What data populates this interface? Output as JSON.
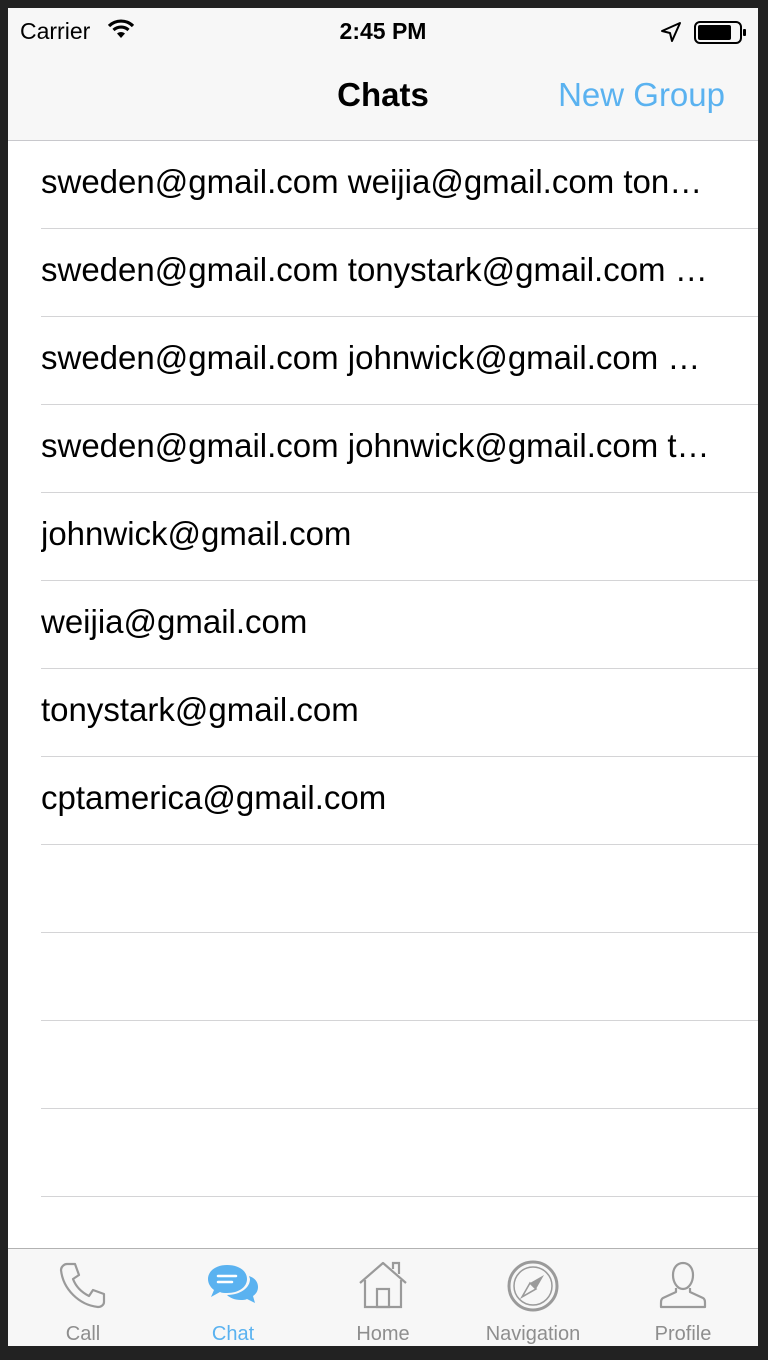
{
  "status_bar": {
    "carrier": "Carrier",
    "time": "2:45 PM"
  },
  "nav": {
    "title": "Chats",
    "action": "New Group"
  },
  "chats": [
    {
      "label": "sweden@gmail.com weijia@gmail.com tonystark@gmail.com"
    },
    {
      "label": "sweden@gmail.com tonystark@gmail.com cptamerica@gmail.com"
    },
    {
      "label": "sweden@gmail.com johnwick@gmail.com weijia@gmail.com"
    },
    {
      "label": "sweden@gmail.com johnwick@gmail.com tonystark@gmail.com"
    },
    {
      "label": "johnwick@gmail.com"
    },
    {
      "label": "weijia@gmail.com"
    },
    {
      "label": "tonystark@gmail.com"
    },
    {
      "label": "cptamerica@gmail.com"
    },
    {
      "label": ""
    },
    {
      "label": ""
    },
    {
      "label": ""
    },
    {
      "label": ""
    },
    {
      "label": ""
    }
  ],
  "tabs": [
    {
      "label": "Call",
      "icon": "phone-icon",
      "active": false
    },
    {
      "label": "Chat",
      "icon": "chat-bubbles-icon",
      "active": true
    },
    {
      "label": "Home",
      "icon": "home-icon",
      "active": false
    },
    {
      "label": "Navigation",
      "icon": "compass-icon",
      "active": false
    },
    {
      "label": "Profile",
      "icon": "person-icon",
      "active": false
    }
  ],
  "colors": {
    "accent": "#5ab2f0",
    "inactive": "#8e8e8e",
    "bar_bg": "#f7f7f7"
  }
}
